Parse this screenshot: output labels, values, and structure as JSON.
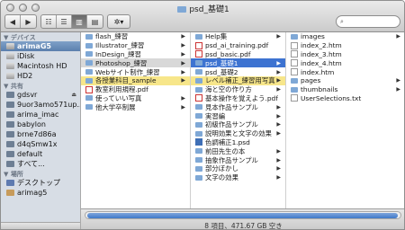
{
  "window": {
    "title": "psd_基礎1",
    "status": "8 項目、471.67 GB 空き"
  },
  "toolbar": {
    "back_label": "◀",
    "forward_label": "▶",
    "views": [
      "☷",
      "☰",
      "▥",
      "▤"
    ],
    "active_view": "column",
    "action_label": "✲▾",
    "search_placeholder": ""
  },
  "sidebar": {
    "sections": [
      {
        "header": "▼ デバイス",
        "items": [
          {
            "label": "arimaG5",
            "icon": "computer-icon",
            "selected": true
          },
          {
            "label": "iDisk",
            "icon": "idisk-icon"
          },
          {
            "label": "Macintosh HD",
            "icon": "hard-drive-icon"
          },
          {
            "label": "HD2",
            "icon": "hard-drive-icon"
          }
        ]
      },
      {
        "header": "▼ 共有",
        "items": [
          {
            "label": "gdsvr",
            "icon": "network-computer-icon",
            "eject": true
          },
          {
            "label": "9uor3amo571up...",
            "icon": "network-computer-icon"
          },
          {
            "label": "arima_imac",
            "icon": "network-computer-icon"
          },
          {
            "label": "babylon",
            "icon": "network-computer-icon"
          },
          {
            "label": "brne7d86a",
            "icon": "network-computer-icon"
          },
          {
            "label": "d4qSmw1x",
            "icon": "network-computer-icon"
          },
          {
            "label": "default",
            "icon": "network-computer-icon"
          },
          {
            "label": "すべて...",
            "icon": "globe-icon"
          }
        ]
      },
      {
        "header": "▼ 場所",
        "items": [
          {
            "label": "デスクトップ",
            "icon": "desktop-icon"
          },
          {
            "label": "arimag5",
            "icon": "home-icon"
          }
        ]
      }
    ]
  },
  "columns": [
    {
      "items": [
        {
          "label": "flash_練習",
          "kind": "folder",
          "arrow": true
        },
        {
          "label": "Illustrator_練習",
          "kind": "folder",
          "arrow": true
        },
        {
          "label": "InDesign_練習",
          "kind": "folder",
          "arrow": true
        },
        {
          "label": "Photoshop_練習",
          "kind": "folder",
          "arrow": true,
          "state": "gray"
        },
        {
          "label": "Webサイト制作_練習",
          "kind": "folder",
          "arrow": true
        },
        {
          "label": "各授業科目_sample",
          "kind": "folder",
          "arrow": true,
          "state": "yellow"
        },
        {
          "label": "教室利用規程.pdf",
          "kind": "pdf"
        },
        {
          "label": "使っていい写真",
          "kind": "folder",
          "arrow": true
        },
        {
          "label": "他大学卒制展",
          "kind": "folder",
          "arrow": true
        }
      ]
    },
    {
      "items": [
        {
          "label": "Help集",
          "kind": "folder",
          "arrow": true
        },
        {
          "label": "psd_ai_training.pdf",
          "kind": "pdf"
        },
        {
          "label": "psd_basic.pdf",
          "kind": "pdf"
        },
        {
          "label": "psd_基礎1",
          "kind": "folder",
          "arrow": true,
          "state": "selected"
        },
        {
          "label": "psd_基礎2",
          "kind": "folder",
          "arrow": true
        },
        {
          "label": "レベル補正_練習用写真",
          "kind": "folder",
          "arrow": true,
          "state": "yellow"
        },
        {
          "label": "海と空の作り方",
          "kind": "folder",
          "arrow": true
        },
        {
          "label": "基本操作を覚えよう.pdf",
          "kind": "pdf"
        },
        {
          "label": "見本作品サンプル",
          "kind": "folder",
          "arrow": true
        },
        {
          "label": "実習編",
          "kind": "folder",
          "arrow": true
        },
        {
          "label": "初級作品サンプル",
          "kind": "folder",
          "arrow": true
        },
        {
          "label": "説明効果と文字の効果",
          "kind": "folder",
          "arrow": true
        },
        {
          "label": "色調補正1.psd",
          "kind": "psd"
        },
        {
          "label": "前田先生の本",
          "kind": "folder",
          "arrow": true
        },
        {
          "label": "抽象作品サンプル",
          "kind": "folder",
          "arrow": true
        },
        {
          "label": "部分ぼかし",
          "kind": "folder",
          "arrow": true
        },
        {
          "label": "文字の効果",
          "kind": "folder",
          "arrow": true
        }
      ]
    },
    {
      "items": [
        {
          "label": "images",
          "kind": "folder",
          "arrow": true
        },
        {
          "label": "index_2.htm",
          "kind": "doc"
        },
        {
          "label": "index_3.htm",
          "kind": "doc"
        },
        {
          "label": "index_4.htm",
          "kind": "doc"
        },
        {
          "label": "index.htm",
          "kind": "doc"
        },
        {
          "label": "pages",
          "kind": "folder",
          "arrow": true
        },
        {
          "label": "thumbnails",
          "kind": "folder",
          "arrow": true
        },
        {
          "label": "UserSelections.txt",
          "kind": "doc"
        }
      ]
    }
  ],
  "scroll": {
    "position_fraction": 0.0,
    "visible_fraction": 0.99
  }
}
